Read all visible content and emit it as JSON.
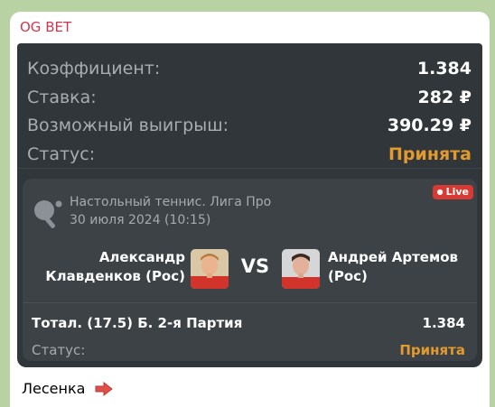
{
  "message": {
    "channel_name": "OG BET",
    "summary_rows": [
      {
        "label": "Коэффициент:",
        "value": "1.384"
      },
      {
        "label": "Ставка:",
        "value": "282 ₽"
      },
      {
        "label": "Возможный выигрыш:",
        "value": "390.29 ₽"
      },
      {
        "label": "Статус:",
        "value": "Принята"
      }
    ],
    "event": {
      "league": "Настольный теннис. Лига Про",
      "datetime": "30 июля 2024 (10:15)",
      "live_badge": "Live",
      "player1": "Александр Клавденков (Рос)",
      "player2": "Андрей Артемов (Рос)",
      "vs_label": "VS",
      "bet_line": "Тотал. (17.5) Б. 2-я Партия",
      "bet_odds": "1.384",
      "status_label": "Статус:",
      "status_value": "Принята"
    },
    "footer_text": "Лесенка"
  },
  "icons": {
    "sport": "table-tennis-icon",
    "footer": "right-arrow-icon"
  },
  "colors": {
    "channel": "#d1364f",
    "card_bg": "#30363a",
    "accepted": "#e29a2f",
    "live": "#d63b33"
  }
}
